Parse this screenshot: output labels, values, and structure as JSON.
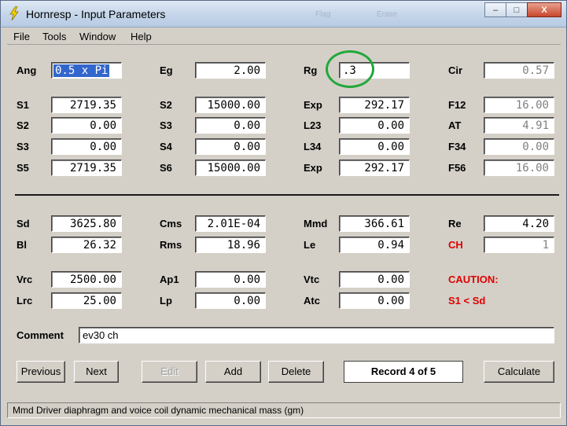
{
  "window": {
    "title": "Hornresp - Input Parameters",
    "ghost_labels": [
      "Flag",
      "Erase"
    ],
    "controls": {
      "minimize": "–",
      "maximize": "□",
      "close": "X"
    }
  },
  "menu": {
    "file": "File",
    "tools": "Tools",
    "window": "Window",
    "help": "Help"
  },
  "params": {
    "ang": {
      "label": "Ang",
      "value": "0.5 x Pi"
    },
    "eg": {
      "label": "Eg",
      "value": "2.00"
    },
    "rg": {
      "label": "Rg",
      "value": ".3"
    },
    "cir": {
      "label": "Cir",
      "value": "0.57"
    },
    "s1": {
      "label": "S1",
      "value": "2719.35"
    },
    "s2b": {
      "label": "S2",
      "value": "15000.00"
    },
    "exp1": {
      "label": "Exp",
      "value": "292.17"
    },
    "f12": {
      "label": "F12",
      "value": "16.00"
    },
    "s2": {
      "label": "S2",
      "value": "0.00"
    },
    "s3b": {
      "label": "S3",
      "value": "0.00"
    },
    "l23": {
      "label": "L23",
      "value": "0.00"
    },
    "at": {
      "label": "AT",
      "value": "4.91"
    },
    "s3": {
      "label": "S3",
      "value": "0.00"
    },
    "s4": {
      "label": "S4",
      "value": "0.00"
    },
    "l34": {
      "label": "L34",
      "value": "0.00"
    },
    "f34": {
      "label": "F34",
      "value": "0.00"
    },
    "s5": {
      "label": "S5",
      "value": "2719.35"
    },
    "s6": {
      "label": "S6",
      "value": "15000.00"
    },
    "exp2": {
      "label": "Exp",
      "value": "292.17"
    },
    "f56": {
      "label": "F56",
      "value": "16.00"
    }
  },
  "driver": {
    "sd": {
      "label": "Sd",
      "value": "3625.80"
    },
    "cms": {
      "label": "Cms",
      "value": "2.01E-04"
    },
    "mmd": {
      "label": "Mmd",
      "value": "366.61"
    },
    "re": {
      "label": "Re",
      "value": "4.20"
    },
    "bl": {
      "label": "Bl",
      "value": "26.32"
    },
    "rms": {
      "label": "Rms",
      "value": "18.96"
    },
    "le": {
      "label": "Le",
      "value": "0.94"
    },
    "ch": {
      "label": "CH",
      "value": "1"
    },
    "vrc": {
      "label": "Vrc",
      "value": "2500.00"
    },
    "ap1": {
      "label": "Ap1",
      "value": "0.00"
    },
    "vtc": {
      "label": "Vtc",
      "value": "0.00"
    },
    "lrc": {
      "label": "Lrc",
      "value": "25.00"
    },
    "lp": {
      "label": "Lp",
      "value": "0.00"
    },
    "atc": {
      "label": "Atc",
      "value": "0.00"
    }
  },
  "caution": {
    "title": "CAUTION:",
    "message": "S1 < Sd"
  },
  "comment": {
    "label": "Comment",
    "value": "ev30 ch"
  },
  "buttons": {
    "previous": "Previous",
    "next": "Next",
    "edit": "Edit",
    "add": "Add",
    "delete": "Delete",
    "record": "Record 4 of 5",
    "calculate": "Calculate"
  },
  "status": "Mmd   Driver diaphragm and voice coil dynamic mechanical mass  (gm)",
  "colors": {
    "accent_red": "#e00000",
    "highlight_ring": "#22a83a",
    "selection": "#3366cc"
  }
}
